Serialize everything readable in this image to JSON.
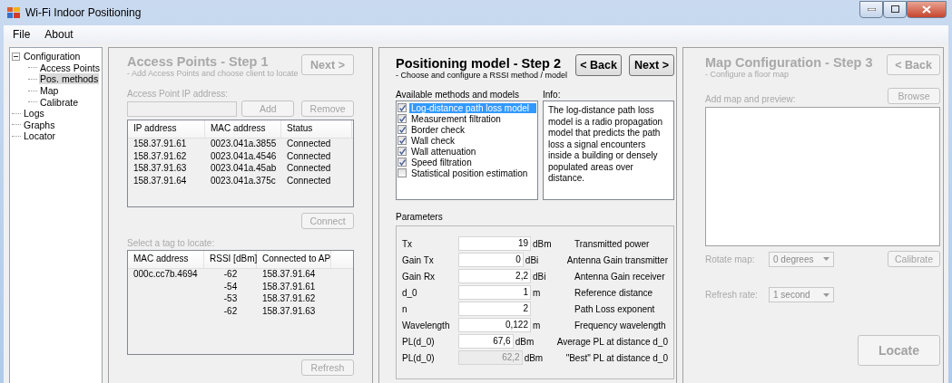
{
  "window": {
    "title": "Wi-Fi Indoor Positioning"
  },
  "menu": [
    "File",
    "About"
  ],
  "tree": [
    {
      "label": "Configuration",
      "expanded": true,
      "selected": false,
      "children": [
        {
          "label": "Access Points",
          "selected": false
        },
        {
          "label": "Pos. methods",
          "selected": true
        },
        {
          "label": "Map",
          "selected": false
        },
        {
          "label": "Calibrate",
          "selected": false
        }
      ]
    },
    {
      "label": "Logs",
      "selected": false
    },
    {
      "label": "Graphs",
      "selected": false
    },
    {
      "label": "Locator",
      "selected": false
    }
  ],
  "step1": {
    "disabled": true,
    "title": "Access Points - Step 1",
    "subtitle": "- Add Access Points and choose client to locate",
    "next_button": "Next >",
    "ip_label": "Access Point IP address:",
    "add_button": "Add",
    "remove_button": "Remove",
    "ap_table": {
      "columns": [
        "IP address",
        "MAC address",
        "Status"
      ],
      "rows": [
        [
          "158.37.91.61",
          "0023.041a.3855",
          "Connected"
        ],
        [
          "158.37.91.62",
          "0023.041a.4546",
          "Connected"
        ],
        [
          "158.37.91.63",
          "0023.041a.45ab",
          "Connected"
        ],
        [
          "158.37.91.64",
          "0023.041a.375c",
          "Connected"
        ]
      ]
    },
    "connect_button": "Connect",
    "tag_label": "Select a tag to locate:",
    "tag_table": {
      "columns": [
        "MAC address",
        "RSSI [dBm]",
        "Connected to AP"
      ],
      "rows": [
        [
          "000c.cc7b.4694",
          "-62",
          "158.37.91.64"
        ],
        [
          "",
          "-54",
          "158.37.91.61"
        ],
        [
          "",
          "-53",
          "158.37.91.62"
        ],
        [
          "",
          "-62",
          "158.37.91.63"
        ]
      ]
    },
    "refresh_button": "Refresh"
  },
  "step2": {
    "disabled": false,
    "title": "Positioning model - Step 2",
    "subtitle": "- Choose and configure a RSSI method / model",
    "back_button": "< Back",
    "next_button": "Next >",
    "methods_label": "Available methods and models",
    "methods": [
      {
        "label": "Log-distance path loss model",
        "checked": true,
        "selected": true
      },
      {
        "label": "Measurement filtration",
        "checked": true,
        "selected": false
      },
      {
        "label": "Border check",
        "checked": true,
        "selected": false
      },
      {
        "label": "Wall check",
        "checked": true,
        "selected": false
      },
      {
        "label": "Wall attenuation",
        "checked": true,
        "selected": false
      },
      {
        "label": "Speed filtration",
        "checked": true,
        "selected": false
      },
      {
        "label": "Statistical position estimation",
        "checked": false,
        "selected": false
      }
    ],
    "info_label": "Info:",
    "info_text": "The log-distance path loss model is a radio propagation model that predicts the path loss a signal encounters inside a building or densely populated areas over distance.",
    "parameters": {
      "title": "Parameters",
      "rows": [
        {
          "label": "Tx",
          "value": "19",
          "unit": "dBm",
          "description": "Transmitted power",
          "disabled": false
        },
        {
          "label": "Gain Tx",
          "value": "0",
          "unit": "dBi",
          "description": "Antenna Gain transmitter",
          "disabled": false
        },
        {
          "label": "Gain Rx",
          "value": "2,2",
          "unit": "dBi",
          "description": "Antenna Gain receiver",
          "disabled": false
        },
        {
          "label": "d_0",
          "value": "1",
          "unit": "m",
          "description": "Reference distance",
          "disabled": false
        },
        {
          "label": "n",
          "value": "2",
          "unit": "",
          "description": "Path Loss exponent",
          "disabled": false
        },
        {
          "label": "Wavelength",
          "value": "0,122",
          "unit": "m",
          "description": "Frequency wavelength",
          "disabled": false
        },
        {
          "label": "PL(d_0)",
          "value": "67,6",
          "unit": "dBm",
          "description": "Average PL at distance d_0",
          "disabled": false
        },
        {
          "label": "PL(d_0)",
          "value": "62,2",
          "unit": "dBm",
          "description": "\"Best\" PL at distance d_0",
          "disabled": true
        }
      ]
    }
  },
  "step3": {
    "disabled": true,
    "title": "Map Configuration - Step 3",
    "subtitle": "- Configure a floor map",
    "back_button": "< Back",
    "browse_button": "Browse",
    "preview_label": "Add map and preview:",
    "rotate_label": "Rotate map:",
    "rotate_value": "0 degrees",
    "calibrate_button": "Calibrate",
    "refresh_label": "Refresh rate:",
    "refresh_value": "1 second",
    "locate_button": "Locate"
  }
}
